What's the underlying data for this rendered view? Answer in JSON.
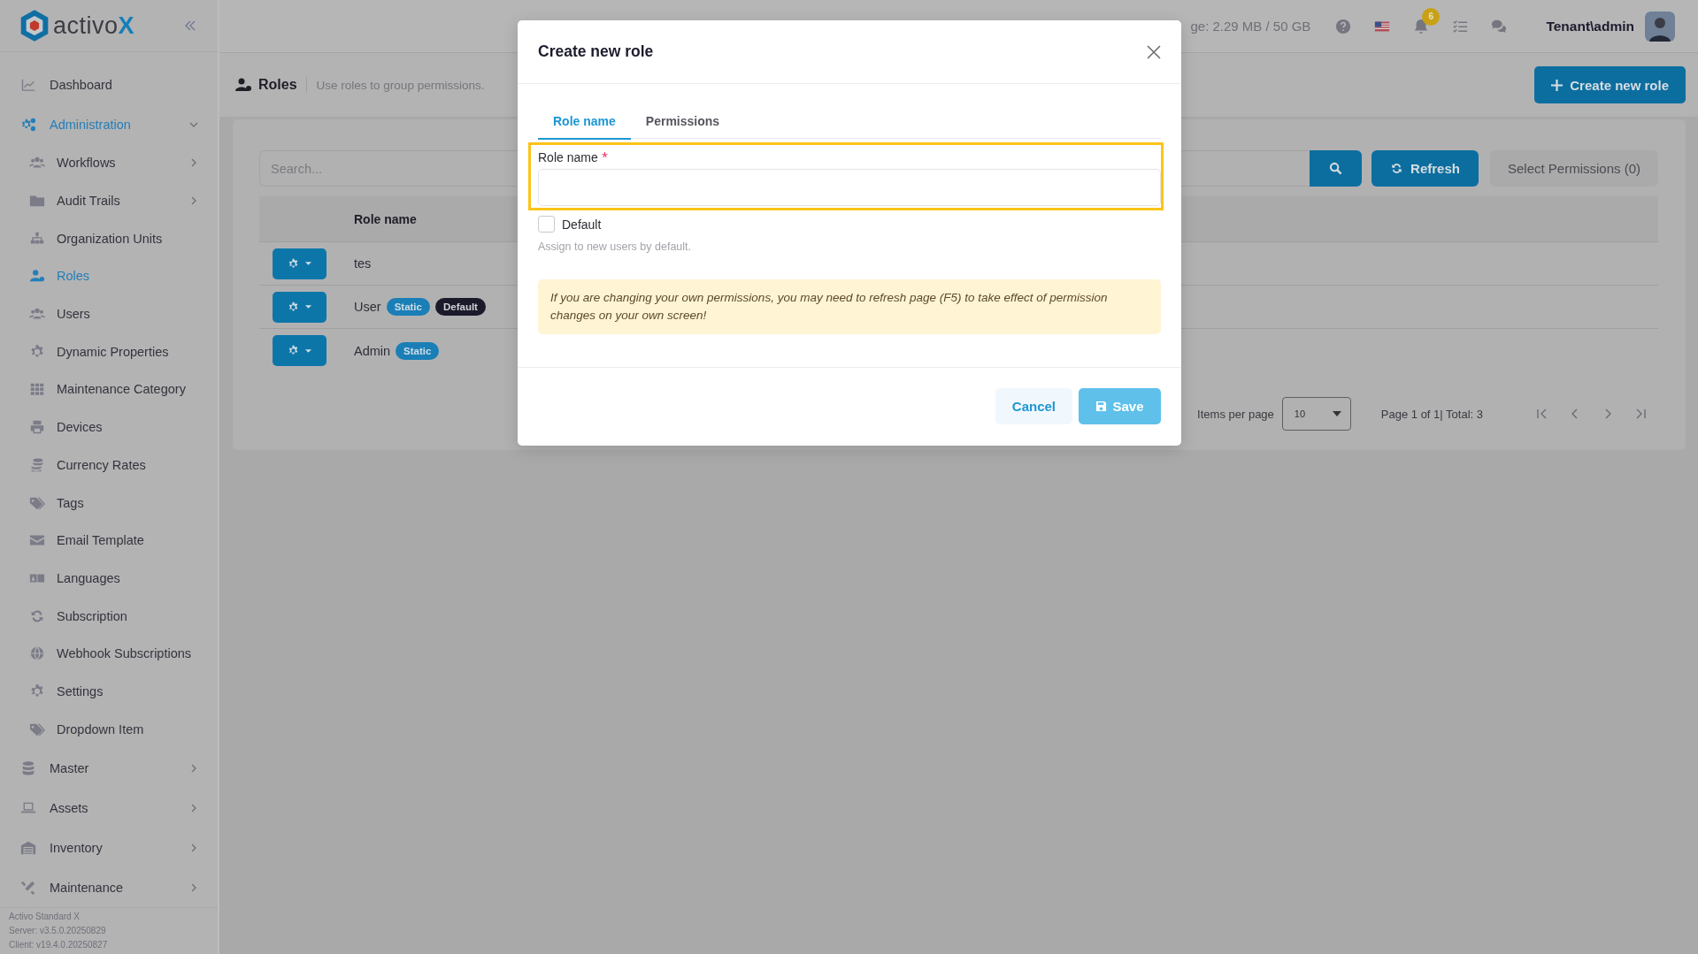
{
  "sidebar": {
    "logo": {
      "text": "activo",
      "accent": "X"
    },
    "items": [
      {
        "label": "Dashboard",
        "selected": false
      },
      {
        "label": "Administration",
        "selected": true,
        "expanded": true,
        "children": [
          {
            "label": "Workflows",
            "selected": false,
            "expanded": false
          },
          {
            "label": "Audit Trails",
            "selected": false,
            "expanded": false
          },
          {
            "label": "Organization Units",
            "selected": false
          },
          {
            "label": "Roles",
            "selected": true
          },
          {
            "label": "Users",
            "selected": false
          },
          {
            "label": "Dynamic Properties",
            "selected": false
          },
          {
            "label": "Maintenance Category",
            "selected": false
          },
          {
            "label": "Devices",
            "selected": false
          },
          {
            "label": "Currency Rates",
            "selected": false
          },
          {
            "label": "Tags",
            "selected": false
          },
          {
            "label": "Email Template",
            "selected": false
          },
          {
            "label": "Languages",
            "selected": false
          },
          {
            "label": "Subscription",
            "selected": false
          },
          {
            "label": "Webhook Subscriptions",
            "selected": false
          },
          {
            "label": "Settings",
            "selected": false
          },
          {
            "label": "Dropdown Item",
            "selected": false
          }
        ]
      },
      {
        "label": "Master",
        "selected": false,
        "expanded": false
      },
      {
        "label": "Assets",
        "selected": false,
        "expanded": false
      },
      {
        "label": "Inventory",
        "selected": false,
        "expanded": false
      },
      {
        "label": "Maintenance",
        "selected": false,
        "expanded": false
      }
    ],
    "footer": [
      "Activo Standard X",
      "Server: v3.5.0.20250829",
      "Client: v19.4.0.20250827"
    ]
  },
  "header": {
    "storage": "ge: 2.29 MB / 50 GB",
    "notifications": "6",
    "user": "Tenant\\admin"
  },
  "page": {
    "title": "Roles",
    "subtitle": "Use roles to group permissions.",
    "create_button": "Create new role"
  },
  "toolbar": {
    "search_placeholder": "Search...",
    "refresh": "Refresh",
    "select_permissions": "Select Permissions (0)"
  },
  "table": {
    "columns": [
      "Role name"
    ],
    "rows": [
      {
        "name": "tes",
        "badges": []
      },
      {
        "name": "User",
        "badges": [
          {
            "label": "Static",
            "kind": "static"
          },
          {
            "label": "Default",
            "kind": "default"
          }
        ]
      },
      {
        "name": "Admin",
        "badges": [
          {
            "label": "Static",
            "kind": "static"
          }
        ]
      }
    ]
  },
  "pagination": {
    "label": "Items per page",
    "page_size": "10",
    "summary": "Page 1 of 1| Total: 3"
  },
  "dialog": {
    "title": "Create new role",
    "tabs": [
      {
        "label": "Role name",
        "selected": true
      },
      {
        "label": "Permissions",
        "selected": false
      }
    ],
    "field": {
      "label": "Role name",
      "required": true
    },
    "default_option": {
      "label": "Default",
      "checked": false,
      "hint": "Assign to new users by default."
    },
    "alert": "If you are changing your own permissions, you may need to refresh page (F5) to take effect of permission changes on your own screen!",
    "buttons": [
      {
        "label": "Cancel",
        "kind": "cancel"
      },
      {
        "label": "Save",
        "kind": "save"
      }
    ]
  }
}
